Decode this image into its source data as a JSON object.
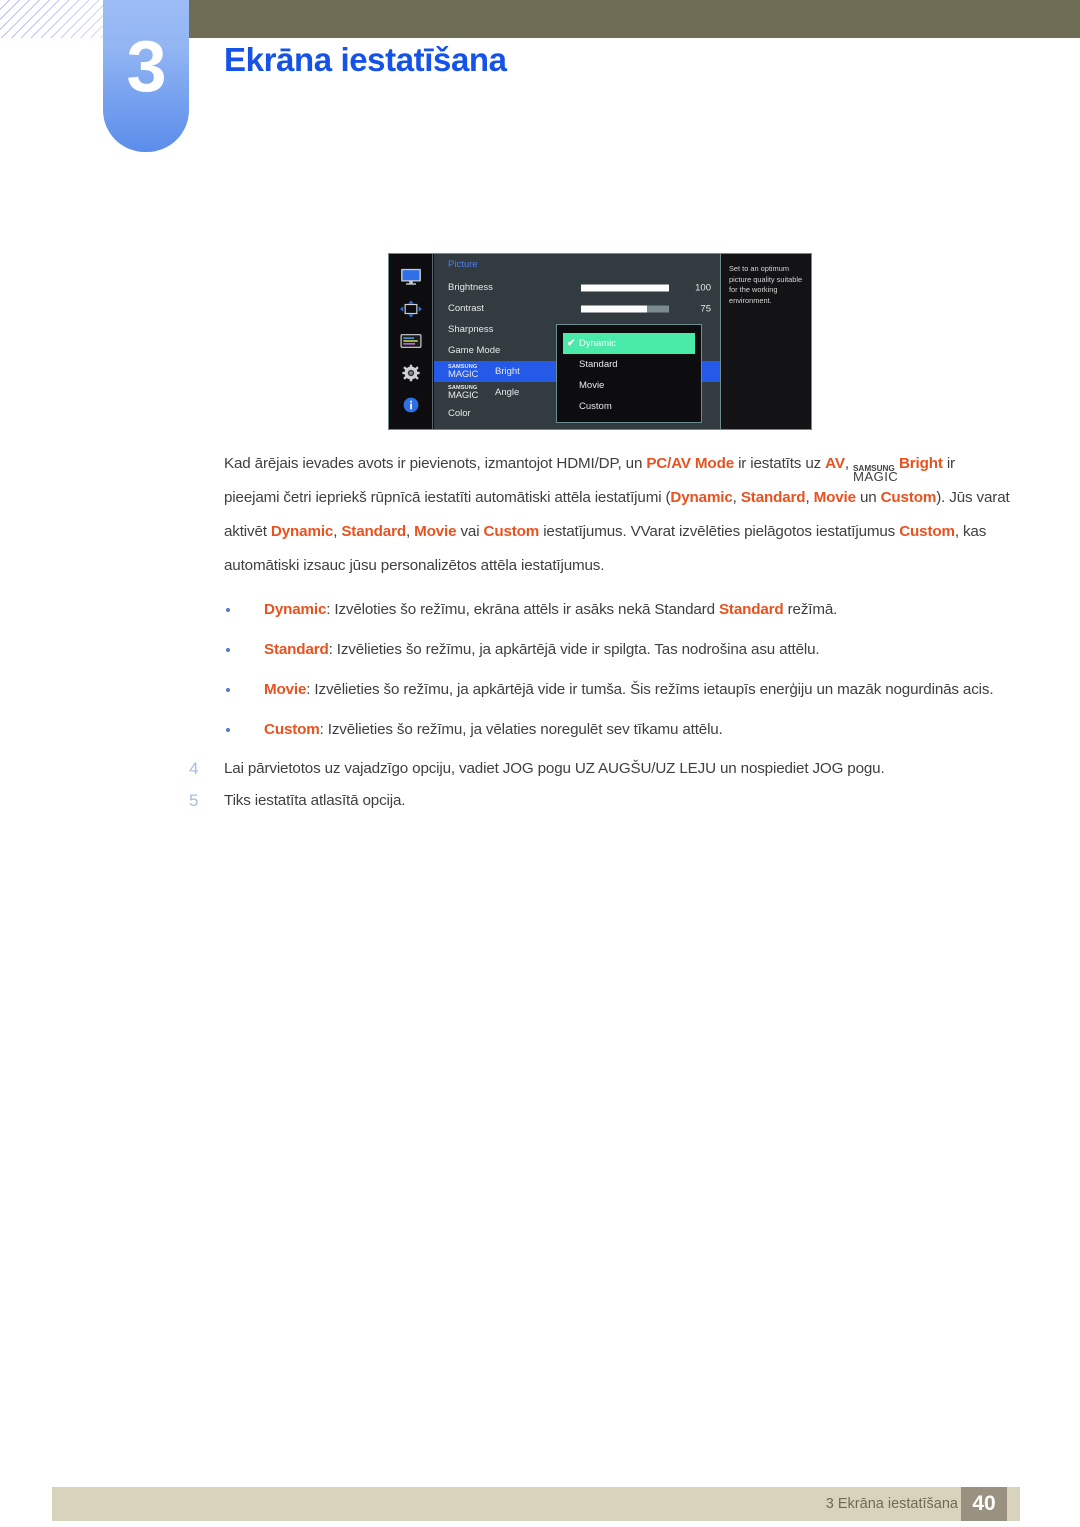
{
  "header": {
    "chapter_number": "3",
    "chapter_title": "Ekrāna iestatīšana"
  },
  "osd": {
    "menu_title": "Picture",
    "icons": [
      "monitor-icon",
      "move-arrows-icon",
      "onscreen-display-icon",
      "gear-icon",
      "info-icon"
    ],
    "rows": [
      {
        "label": "Brightness",
        "value": "100",
        "fill_percent": 100
      },
      {
        "label": "Contrast",
        "value": "75",
        "fill_percent": 75
      },
      {
        "label": "Sharpness",
        "value": "",
        "fill_percent": null
      },
      {
        "label": "Game Mode",
        "value": "",
        "fill_percent": null
      },
      {
        "label_brand": "SAMSUNG",
        "label_magic": "MAGIC",
        "label_suffix": "Bright",
        "selected": true
      },
      {
        "label_brand": "SAMSUNG",
        "label_magic": "MAGIC",
        "label_suffix": "Angle"
      },
      {
        "label": "Color",
        "value": "",
        "fill_percent": null
      }
    ],
    "dropdown": {
      "items": [
        {
          "label": "Dynamic",
          "selected": true,
          "check": "✔"
        },
        {
          "label": "Standard",
          "selected": false
        },
        {
          "label": "Movie",
          "selected": false
        },
        {
          "label": "Custom",
          "selected": false
        }
      ]
    },
    "help_text": "Set to an optimum picture quality suitable for the working environment.",
    "colors": {
      "highlight_row": "#2559e8",
      "highlight_option": "#4aeaa8",
      "title_blue": "#4f7ef0"
    }
  },
  "content": {
    "paragraph": {
      "line1_a": "Kad ārējais ievades avots ir pievienots, izmantojot HDMI/DP, un ",
      "line1_hl1": "PC/AV Mode",
      "line1_b": " ir iestatīts uz ",
      "line1_hl2": "AV",
      "line1_c": ", ",
      "magic_brand": "SAMSUNG",
      "magic_word": "MAGIC",
      "magic_suffix": "Bright",
      "line2_a": " ir pieejami četri iepriekš rūpnīcā iestatīti automātiski attēla iestatījumi (",
      "hl_dynamic": "Dynamic",
      "sep1": ", ",
      "hl_standard": "Standard",
      "sep2": ", ",
      "hl_movie": "Movie",
      "join_un": " un ",
      "hl_custom": "Custom",
      "line3_a": "). Jūs varat aktivēt ",
      "hl_dynamic2": "Dynamic",
      "sep3": ", ",
      "hl_standard2": "Standard",
      "sep4": ", ",
      "hl_movie2": "Movie",
      "join_vai": " vai ",
      "hl_custom2": "Custom",
      "line4_a": " iestatījumus. VVarat izvēlēties pielāgotos iestatījumus ",
      "hl_custom3": "Custom",
      "line4_b": ", kas automātiski izsauc jūsu personalizētos attēla iestatījumus."
    },
    "bullets": [
      {
        "term": "Dynamic",
        "text_a": ": Izvēloties šo režīmu, ekrāna attēls ir asāks nekā Standard ",
        "term2": "Standard",
        "text_b": " režīmā."
      },
      {
        "term": "Standard",
        "text_a": ": Izvēlieties šo režīmu, ja apkārtējā vide ir spilgta. Tas nodrošina asu attēlu.",
        "term2": "",
        "text_b": ""
      },
      {
        "term": "Movie",
        "text_a": ": Izvēlieties šo režīmu, ja apkārtējā vide ir tumša. Šis režīms ietaupīs enerģiju un mazāk nogurdinās acis.",
        "term2": "",
        "text_b": ""
      },
      {
        "term": "Custom",
        "text_a": ": Izvēlieties šo režīmu, ja vēlaties noregulēt sev tīkamu attēlu.",
        "term2": "",
        "text_b": ""
      }
    ],
    "steps": [
      {
        "num": "4",
        "text": "Lai pārvietotos uz vajadzīgo opciju, vadiet JOG pogu UZ AUGŠU/UZ LEJU un nospiediet JOG pogu."
      },
      {
        "num": "5",
        "text": "Tiks iestatīta atlasītā opcija."
      }
    ]
  },
  "footer": {
    "section_label": "3 Ekrāna iestatīšana",
    "page_number": "40"
  }
}
